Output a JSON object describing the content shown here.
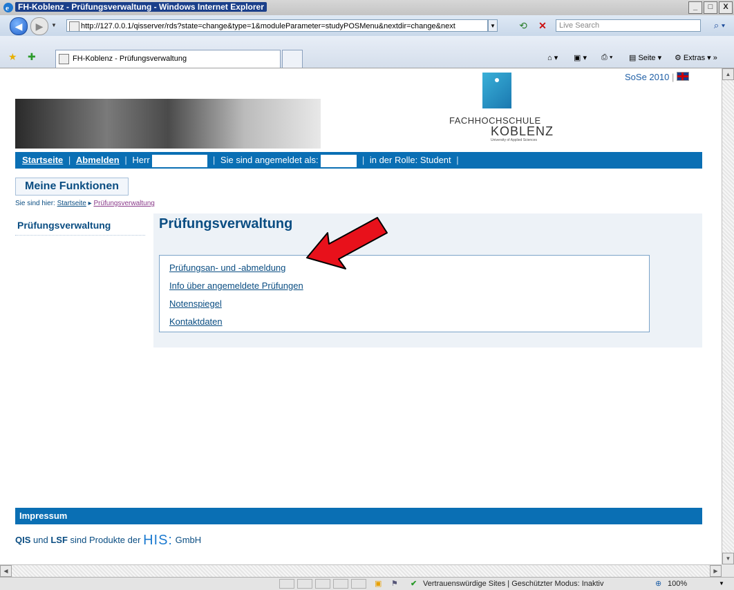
{
  "window": {
    "title": "FH-Koblenz - Prüfungsverwaltung - Windows Internet Explorer",
    "min": "_",
    "max": "□",
    "close": "X"
  },
  "address_bar": {
    "url": "http://127.0.0.1/qisserver/rds?state=change&type=1&moduleParameter=studyPOSMenu&nextdir=change&next",
    "search_placeholder": "Live Search"
  },
  "tab": {
    "title": "FH-Koblenz - Prüfungsverwaltung"
  },
  "commands": {
    "page": "Seite",
    "extras": "Extras"
  },
  "page": {
    "semester": "SoSe 2010",
    "logo": {
      "line1": "FACHHOCHSCHULE",
      "line2": "KOBLENZ",
      "line3": "University of Applied Sciences"
    },
    "nav": {
      "home": "Startseite",
      "logout": "Abmelden",
      "sep": "|",
      "salutation": "Herr",
      "logged_in_as": "Sie sind angemeldet als:",
      "role": "in der Rolle: Student"
    },
    "my_functions": "Meine Funktionen",
    "breadcrumb": {
      "prefix": "Sie sind hier:",
      "home": "Startseite",
      "current": "Prüfungsverwaltung"
    },
    "sidebar": {
      "item": "Prüfungsverwaltung"
    },
    "main": {
      "title": "Prüfungsverwaltung",
      "links": [
        "Prüfungsan- und -abmeldung",
        "Info über angemeldete Prüfungen",
        "Notenspiegel",
        "Kontaktdaten"
      ]
    },
    "footer": {
      "impressum": "Impressum",
      "qis": "QIS",
      "und": "und",
      "lsf": "LSF",
      "rest": "sind Produkte der",
      "his": "HIS:",
      "gmbh": "GmbH"
    }
  },
  "status": {
    "zone": "Vertrauenswürdige Sites | Geschützter Modus: Inaktiv",
    "zoom": "100%"
  },
  "colors": {
    "nav_blue": "#0a6fb4",
    "link_blue": "#0a4d82",
    "arrow_red": "#e8111b"
  }
}
